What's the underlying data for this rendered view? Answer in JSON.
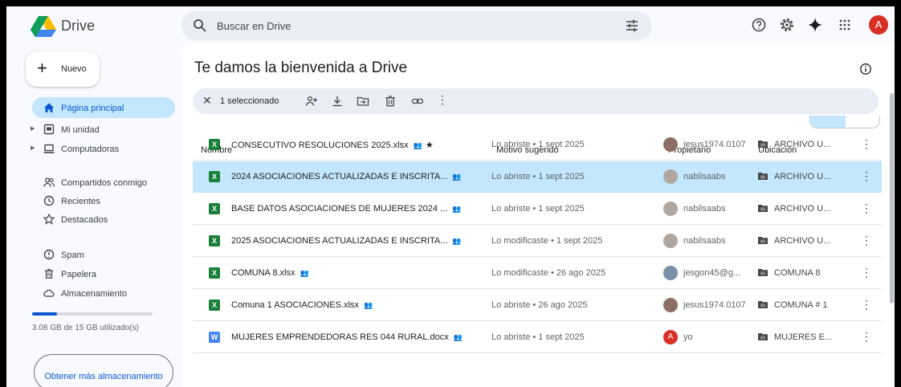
{
  "app": {
    "name": "Drive"
  },
  "search": {
    "placeholder": "Buscar en Drive"
  },
  "account": {
    "avatar_letter": "A"
  },
  "sidebar": {
    "new_label": "Nuevo",
    "items": [
      {
        "label": "Página principal",
        "icon": "home-icon"
      },
      {
        "label": "Mi unidad",
        "icon": "drive-icon"
      },
      {
        "label": "Computadoras",
        "icon": "computer-icon"
      },
      {
        "label": "Compartidos conmigo",
        "icon": "people-icon"
      },
      {
        "label": "Recientes",
        "icon": "clock-icon"
      },
      {
        "label": "Destacados",
        "icon": "star-icon"
      },
      {
        "label": "Spam",
        "icon": "spam-icon"
      },
      {
        "label": "Papelera",
        "icon": "trash-icon"
      },
      {
        "label": "Almacenamiento",
        "icon": "cloud-icon"
      }
    ],
    "storage_used_fraction": 0.205,
    "storage_text": "3.08 GB de 15 GB utilizado(s)",
    "more_storage_label": "Obtener más almacenamiento"
  },
  "main": {
    "title": "Te damos la bienvenida a Drive",
    "selection": {
      "count_label": "1 seleccionado"
    },
    "columns": [
      "Nombre",
      "Motivo sugerido",
      "Propietario",
      "Ubicación"
    ],
    "files": [
      {
        "type": "xlsx",
        "name": "CONSECUTIVO RESOLUCIONES 2025.xlsx",
        "starred": true,
        "reason": "Lo abriste • 1 sept 2025",
        "owner": "jesus1974.0107",
        "location": "ARCHIVO U...",
        "selected": false
      },
      {
        "type": "xlsx",
        "name": "2024 ASOCIACIONES ACTUALIZADAS E INSCRITA...",
        "starred": false,
        "reason": "Lo abriste • 1 sept 2025",
        "owner": "nabilsaabs",
        "location": "ARCHIVO U...",
        "selected": true
      },
      {
        "type": "xlsx",
        "name": "BASE DATOS ASOCIACIONES DE MUJERES 2024 ...",
        "starred": false,
        "reason": "Lo abriste • 1 sept 2025",
        "owner": "nabilsaabs",
        "location": "ARCHIVO U...",
        "selected": false
      },
      {
        "type": "xlsx",
        "name": "2025 ASOCIACIONES ACTUALIZADAS E INSCRITA...",
        "starred": false,
        "reason": "Lo modificaste • 1 sept 2025",
        "owner": "nabilsaabs",
        "location": "ARCHIVO U...",
        "selected": false
      },
      {
        "type": "xlsx",
        "name": "COMUNA 8.xlsx",
        "starred": false,
        "reason": "Lo modificaste • 26 ago 2025",
        "owner": "jesgon45@g...",
        "location": "COMUNA 8",
        "selected": false
      },
      {
        "type": "xlsx",
        "name": "Comuna 1 ASOCIACIONES.xlsx",
        "starred": false,
        "reason": "Lo abriste • 26 ago 2025",
        "owner": "jesus1974.0107",
        "location": "COMUNA # 1",
        "selected": false
      },
      {
        "type": "docx",
        "name": "MUJERES EMPRENDEDORAS RES 044 RURAL.docx",
        "starred": false,
        "reason": "Lo abriste • 1 sept 2025",
        "owner": "yo",
        "owner_initial": "A",
        "location": "MUJERES E...",
        "selected": false
      }
    ]
  },
  "colors": {
    "accent": "#0b57d0",
    "active_bg": "#c2e7ff",
    "sheets_green": "#188038",
    "docs_blue": "#4285f4",
    "avatar_red": "#d93025"
  }
}
